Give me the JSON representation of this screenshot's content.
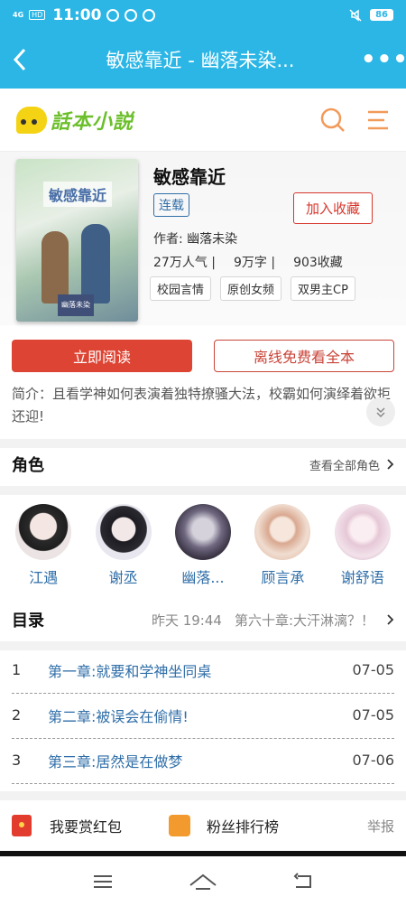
{
  "status_bar": {
    "network": "4G",
    "hd": "HD",
    "time": "11:00",
    "battery": "86"
  },
  "nav": {
    "title": "敏感靠近 - 幽落未染..."
  },
  "header": {
    "logo_text": "話本小説"
  },
  "book": {
    "cover_title": "敏感靠近",
    "cover_author": "幽落未染",
    "title": "敏感靠近",
    "status": "连载",
    "favorite_label": "加入收藏",
    "author": "作者: 幽落未染",
    "popularity": "27万人气 |",
    "words": "9万字 |",
    "favorites": "903收藏",
    "tags": [
      "校园言情",
      "原创女频",
      "双男主CP"
    ]
  },
  "actions": {
    "read_label": "立即阅读",
    "offline_label": "离线免费看全本"
  },
  "intro": {
    "text": "简介：且看学神如何表演着独特撩骚大法，校霸如何演绎着欲拒还迎!"
  },
  "roles": {
    "title": "角色",
    "view_all": "查看全部角色",
    "items": [
      {
        "name": "江遇",
        "color": "#e9dede"
      },
      {
        "name": "谢丞",
        "color": "#e4e2ea"
      },
      {
        "name": "幽落...",
        "color": "#6f6880"
      },
      {
        "name": "顾言承",
        "color": "#f0ddd0"
      },
      {
        "name": "谢舒语",
        "color": "#f2e2ea"
      }
    ]
  },
  "toc": {
    "title": "目录",
    "updated": "昨天 19:44",
    "latest": "第六十章:大汗淋漓？！",
    "chapters": [
      {
        "no": "1",
        "title": "第一章:就要和学神坐同桌",
        "date": "07-05"
      },
      {
        "no": "2",
        "title": "第二章:被误会在偷情!",
        "date": "07-05"
      },
      {
        "no": "3",
        "title": "第三章:居然是在做梦",
        "date": "07-06"
      }
    ]
  },
  "bottom": {
    "reward": "我要赏红包",
    "fans": "粉丝排行榜",
    "report": "举报"
  }
}
